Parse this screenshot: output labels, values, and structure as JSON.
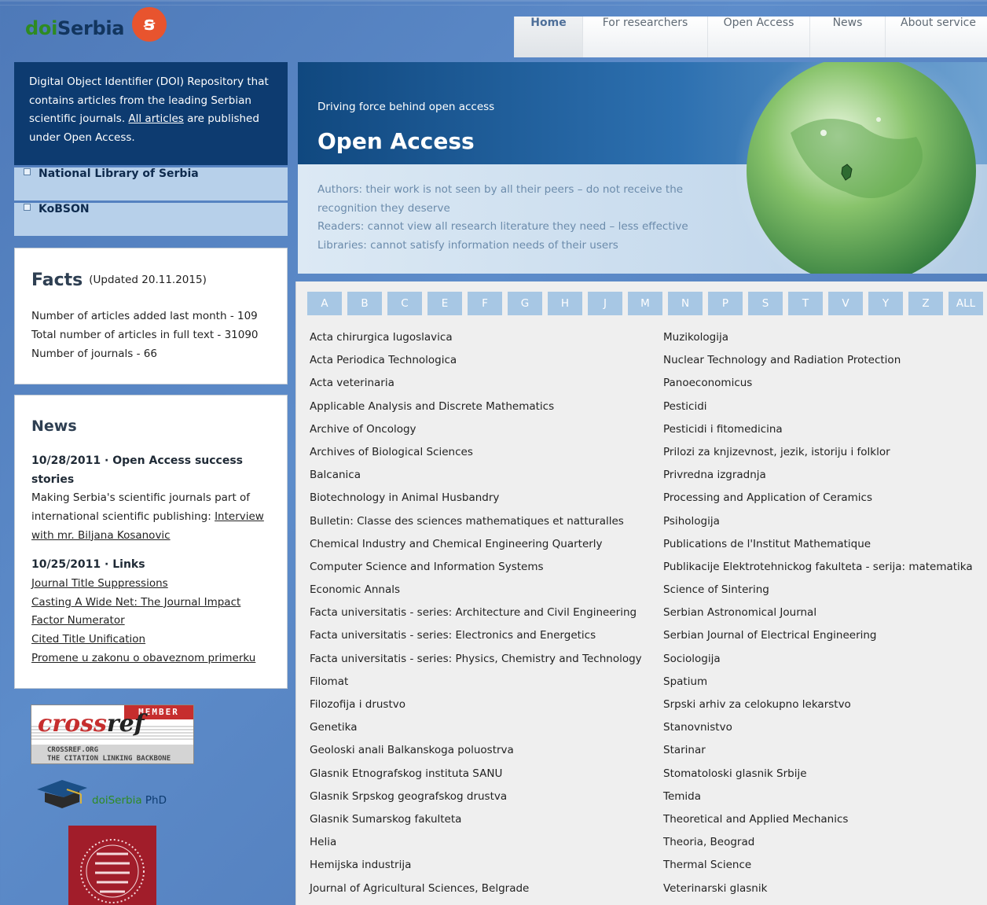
{
  "logo": {
    "part1": "doi",
    "part2": "Serbia",
    "badge_glyph": "ꞩ"
  },
  "nav": [
    "Home",
    "For researchers",
    "Open Access",
    "News",
    "About service"
  ],
  "intro": {
    "before_link": "Digital Object Identifier (DOI) Repository that contains articles from the leading Serbian scientific journals. ",
    "link": "All articles",
    "after_link": " are published under Open Access."
  },
  "side_links": [
    "National Library of Serbia",
    "KoBSON"
  ],
  "facts": {
    "title": "Facts",
    "updated": "(Updated 20.11.2015)",
    "rows": [
      "Number of articles added last month - 109",
      "Total number of articles in full text - 31090",
      "Number of journals - 66"
    ]
  },
  "news": {
    "title": "News",
    "item1": {
      "heading": "10/28/2011 · Open Access success stories",
      "text": "Making Serbia's scientific journals part of international scientific publishing: ",
      "link": "Interview with mr. Biljana Kosanovic"
    },
    "item2": {
      "heading": "10/25/2011 · Links",
      "links": [
        "Journal Title Suppressions",
        "Casting A Wide Net: The Journal Impact Factor Numerator",
        "Cited Title Unification",
        "Promene u zakonu o obaveznom primerku"
      ]
    }
  },
  "crossref": {
    "member": "MEMBER",
    "word_a": "cross",
    "word_b": "ref",
    "line1": "CROSSREF.ORG",
    "line2": "THE CITATION LINKING BACKBONE"
  },
  "phd": {
    "part1": "doiSerbia",
    "part2": " PhD"
  },
  "hero": {
    "kicker": "Driving force behind open access",
    "title": "Open Access",
    "lines": [
      "Authors: their work is not seen by all their peers – do not receive the recognition they deserve",
      "Readers: cannot view all research literature they need – less effective",
      "Libraries: cannot satisfy information needs of their users"
    ]
  },
  "letters": [
    "A",
    "B",
    "C",
    "E",
    "F",
    "G",
    "H",
    "J",
    "M",
    "N",
    "P",
    "S",
    "T",
    "V",
    "Y",
    "Z",
    "ALL"
  ],
  "journals_left": [
    "Acta chirurgica Iugoslavica",
    "Acta Periodica Technologica",
    "Acta veterinaria",
    "Applicable Analysis and Discrete Mathematics",
    "Archive of Oncology",
    "Archives of Biological Sciences",
    "Balcanica",
    "Biotechnology in Animal Husbandry",
    "Bulletin: Classe des sciences mathematiques et natturalles",
    "Chemical Industry and Chemical Engineering Quarterly",
    "Computer Science and Information Systems",
    "Economic Annals",
    "Facta universitatis - series: Architecture and Civil Engineering",
    "Facta universitatis - series: Electronics and Energetics",
    "Facta universitatis - series: Physics, Chemistry and Technology",
    "Filomat",
    "Filozofija i drustvo",
    "Genetika",
    "Geoloski anali Balkanskoga poluostrva",
    "Glasnik Etnografskog instituta SANU",
    "Glasnik Srpskog geografskog drustva",
    "Glasnik Sumarskog fakulteta",
    "Helia",
    "Hemijska industrija",
    "Journal of Agricultural Sciences, Belgrade"
  ],
  "journals_right": [
    "Muzikologija",
    "Nuclear Technology and Radiation Protection",
    "Panoeconomicus",
    "Pesticidi",
    "Pesticidi i fitomedicina",
    "Prilozi za knjizevnost, jezik, istoriju i folklor",
    "Privredna izgradnja",
    "Processing and Application of Ceramics",
    "Psihologija",
    "Publications de l'Institut Mathematique",
    "Publikacije Elektrotehnickog fakulteta - serija: matematika",
    "Science of Sintering",
    "Serbian Astronomical Journal",
    "Serbian Journal of Electrical Engineering",
    "Sociologija",
    "Spatium",
    "Srpski arhiv za celokupno lekarstvo",
    "Stanovnistvo",
    "Starinar",
    "Stomatoloski glasnik Srbije",
    "Temida",
    "Theoretical and Applied Mechanics",
    "Theoria, Beograd",
    "Thermal Science",
    "Veterinarski glasnik"
  ]
}
